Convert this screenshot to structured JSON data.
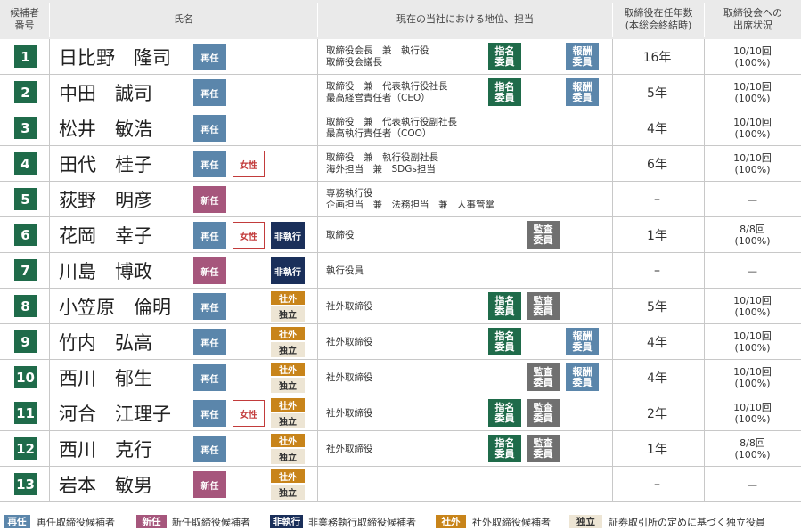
{
  "headers": {
    "num": "候補者\n番号",
    "name": "氏名",
    "position": "現在の当社における地位、担当",
    "tenure": "取締役在任年数\n(本総会終結時)",
    "attendance": "取締役会への\n出席状況"
  },
  "badge_labels": {
    "sainin": "再任",
    "shinnin": "新任",
    "josei": "女性",
    "hishikko": "非執行",
    "shagai": "社外",
    "dokuritsu": "独立",
    "shimei": "指名\n委員",
    "kansa": "監査\n委員",
    "hoshu": "報酬\n委員"
  },
  "colors": {
    "number_box": "#1f6b4a",
    "sainin": "#5b86ab",
    "shinnin": "#a6567c",
    "josei": "#c23b3b",
    "hishikko": "#1a2f5a",
    "shagai": "#c8841a",
    "dokuritsu": "#ede5d4",
    "shimei": "#1f6b4a",
    "kansa": "#707070",
    "hoshu": "#5b86ab",
    "header_bg": "#eaeaea"
  },
  "candidates": [
    {
      "num": "1",
      "name": "日比野　隆司",
      "type": "sainin",
      "female": false,
      "nonexec": false,
      "outside": false,
      "pos": [
        "取締役会長　兼　執行役",
        "取締役会議長"
      ],
      "shimei": true,
      "kansa": false,
      "hoshu": true,
      "years": "16年",
      "att": "10/10回\n(100%)"
    },
    {
      "num": "2",
      "name": "中田　誠司",
      "type": "sainin",
      "female": false,
      "nonexec": false,
      "outside": false,
      "pos": [
        "取締役　兼　代表執行役社長",
        "最高経営責任者（CEO）"
      ],
      "shimei": true,
      "kansa": false,
      "hoshu": true,
      "years": "5年",
      "att": "10/10回\n(100%)"
    },
    {
      "num": "3",
      "name": "松井　敏浩",
      "type": "sainin",
      "female": false,
      "nonexec": false,
      "outside": false,
      "pos": [
        "取締役　兼　代表執行役副社長",
        "最高執行責任者（COO）"
      ],
      "shimei": false,
      "kansa": false,
      "hoshu": false,
      "years": "4年",
      "att": "10/10回\n(100%)"
    },
    {
      "num": "4",
      "name": "田代　桂子",
      "type": "sainin",
      "female": true,
      "nonexec": false,
      "outside": false,
      "pos": [
        "取締役　兼　執行役副社長",
        "海外担当　兼　SDGs担当"
      ],
      "shimei": false,
      "kansa": false,
      "hoshu": false,
      "years": "6年",
      "att": "10/10回\n(100%)"
    },
    {
      "num": "5",
      "name": "荻野　明彦",
      "type": "shinnin",
      "female": false,
      "nonexec": false,
      "outside": false,
      "pos": [
        "専務執行役",
        "企画担当　兼　法務担当　兼　人事管掌"
      ],
      "shimei": false,
      "kansa": false,
      "hoshu": false,
      "years": "–",
      "att": "—"
    },
    {
      "num": "6",
      "name": "花岡　幸子",
      "type": "sainin",
      "female": true,
      "nonexec": true,
      "outside": false,
      "pos": [
        "取締役"
      ],
      "shimei": false,
      "kansa": true,
      "hoshu": false,
      "years": "1年",
      "att": "8/8回\n(100%)"
    },
    {
      "num": "7",
      "name": "川島　博政",
      "type": "shinnin",
      "female": false,
      "nonexec": true,
      "outside": false,
      "pos": [
        "執行役員"
      ],
      "shimei": false,
      "kansa": false,
      "hoshu": false,
      "years": "–",
      "att": "—"
    },
    {
      "num": "8",
      "name": "小笠原　倫明",
      "type": "sainin",
      "female": false,
      "nonexec": false,
      "outside": true,
      "pos": [
        "社外取締役"
      ],
      "shimei": true,
      "kansa": true,
      "hoshu": false,
      "years": "5年",
      "att": "10/10回\n(100%)"
    },
    {
      "num": "9",
      "name": "竹内　弘高",
      "type": "sainin",
      "female": false,
      "nonexec": false,
      "outside": true,
      "pos": [
        "社外取締役"
      ],
      "shimei": true,
      "kansa": false,
      "hoshu": true,
      "years": "4年",
      "att": "10/10回\n(100%)"
    },
    {
      "num": "10",
      "name": "西川　郁生",
      "type": "sainin",
      "female": false,
      "nonexec": false,
      "outside": true,
      "pos": [
        "社外取締役"
      ],
      "shimei": false,
      "kansa": true,
      "hoshu": true,
      "years": "4年",
      "att": "10/10回\n(100%)"
    },
    {
      "num": "11",
      "name": "河合　江理子",
      "type": "sainin",
      "female": true,
      "nonexec": false,
      "outside": true,
      "pos": [
        "社外取締役"
      ],
      "shimei": true,
      "kansa": true,
      "hoshu": false,
      "years": "2年",
      "att": "10/10回\n(100%)"
    },
    {
      "num": "12",
      "name": "西川　克行",
      "type": "sainin",
      "female": false,
      "nonexec": false,
      "outside": true,
      "pos": [
        "社外取締役"
      ],
      "shimei": true,
      "kansa": true,
      "hoshu": false,
      "years": "1年",
      "att": "8/8回\n(100%)"
    },
    {
      "num": "13",
      "name": "岩本　敏男",
      "type": "shinnin",
      "female": false,
      "nonexec": false,
      "outside": true,
      "pos": [],
      "shimei": false,
      "kansa": false,
      "hoshu": false,
      "years": "–",
      "att": "—"
    }
  ],
  "legend": [
    {
      "badge": "再任",
      "style": "sainin",
      "text": "再任取締役候補者"
    },
    {
      "badge": "新任",
      "style": "shinnin",
      "text": "新任取締役候補者"
    },
    {
      "badge": "非執行",
      "style": "hishikko",
      "text": "非業務執行取締役候補者"
    },
    {
      "badge": "社外",
      "style": "shagai",
      "text": "社外取締役候補者"
    },
    {
      "badge": "独立",
      "style": "dokuritsu",
      "text": "証券取引所の定めに基づく独立役員"
    }
  ]
}
